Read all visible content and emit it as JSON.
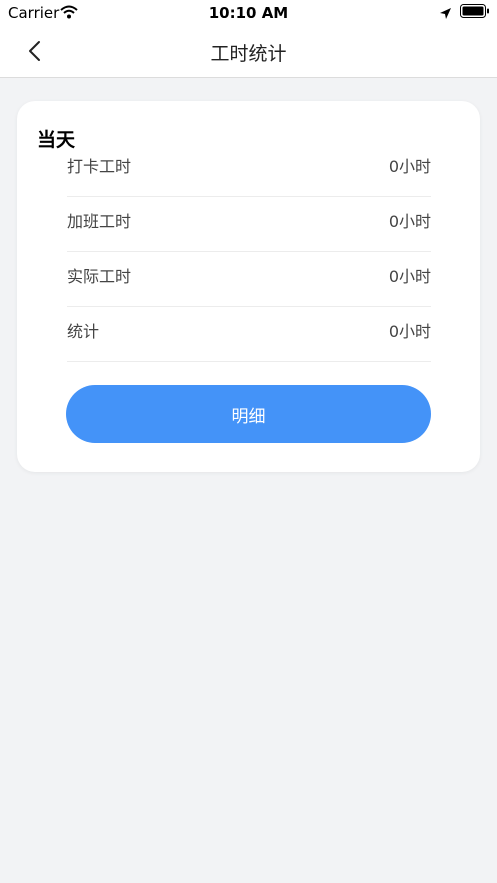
{
  "status_bar": {
    "carrier": "Carrier",
    "time": "10:10 AM"
  },
  "nav": {
    "title": "工时统计"
  },
  "card": {
    "title": "当天",
    "rows": [
      {
        "label": "打卡工时",
        "value": "0小时"
      },
      {
        "label": "加班工时",
        "value": "0小时"
      },
      {
        "label": "实际工时",
        "value": "0小时"
      },
      {
        "label": "统计",
        "value": "0小时"
      }
    ],
    "button_label": "明细"
  },
  "colors": {
    "accent": "#4493f8",
    "background": "#f2f3f5"
  }
}
